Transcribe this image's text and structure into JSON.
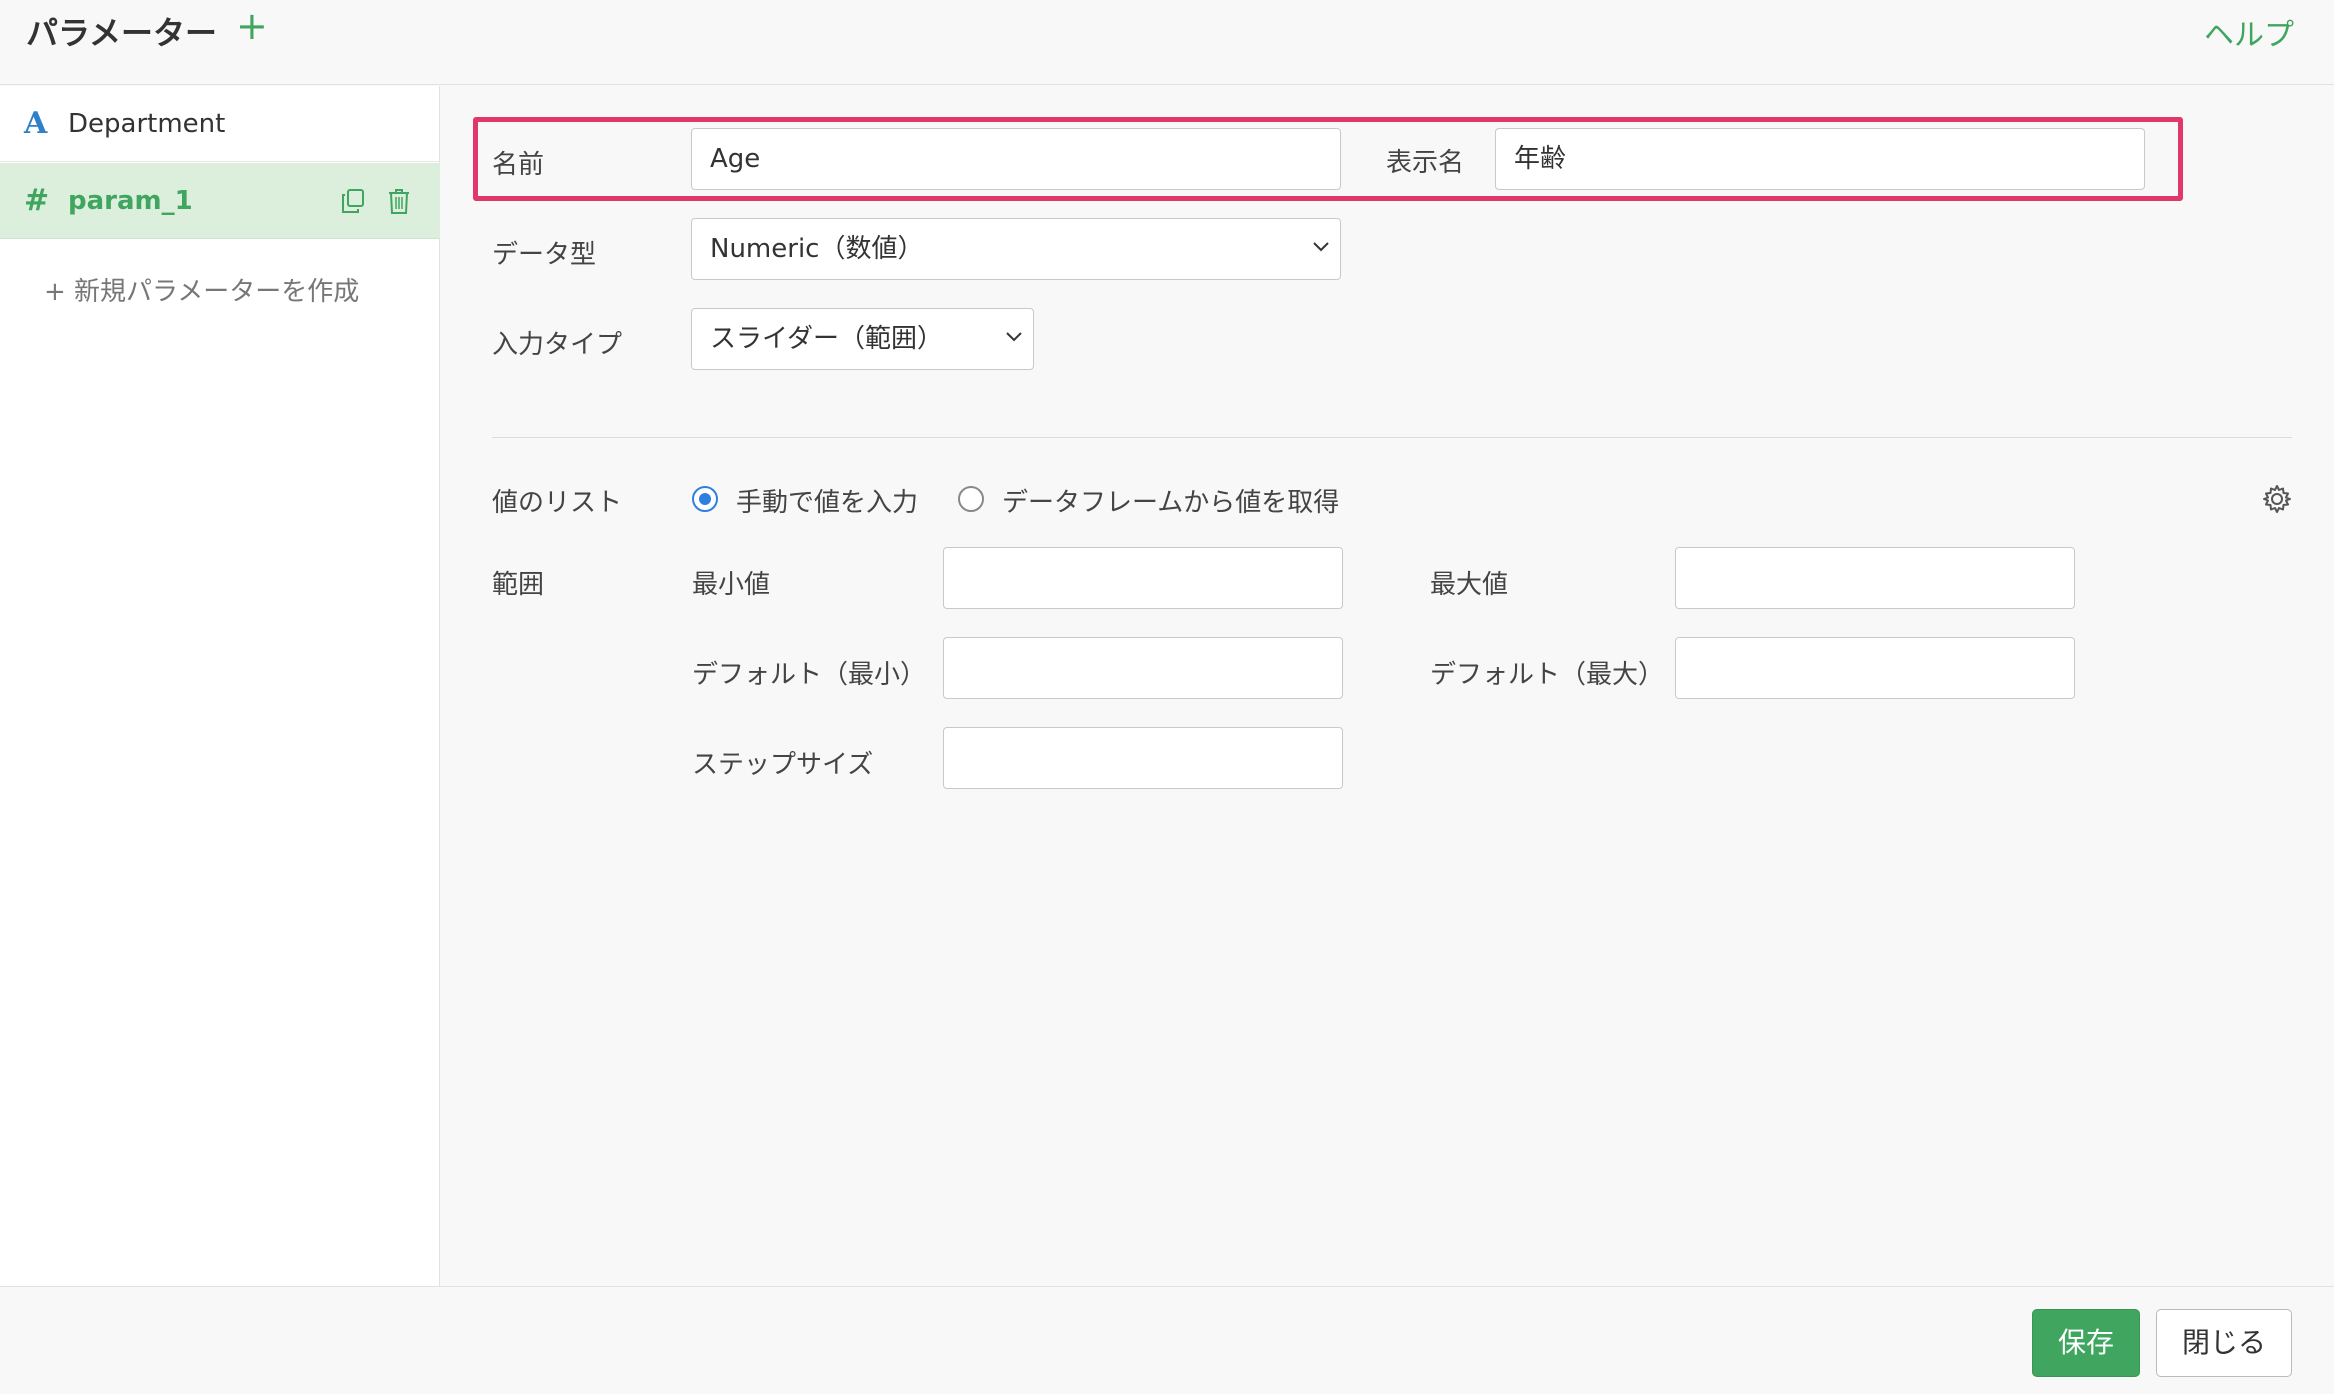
{
  "header": {
    "title": "パラメーター",
    "add_symbol": "+",
    "help_link": "ヘルプ"
  },
  "sidebar": {
    "items": [
      {
        "type_icon": "A",
        "label": "Department",
        "selected": false
      },
      {
        "type_icon": "#",
        "label": "param_1",
        "selected": true
      }
    ],
    "new_param": "+ 新規パラメーターを作成"
  },
  "form": {
    "name_label": "名前",
    "name_value": "Age",
    "display_name_label": "表示名",
    "display_name_value": "年齢",
    "data_type_label": "データ型",
    "data_type_value": "Numeric（数値）",
    "input_type_label": "入力タイプ",
    "input_type_value": "スライダー（範囲）",
    "value_list_label": "値のリスト",
    "value_list_options": [
      {
        "label": "手動で値を入力",
        "checked": true
      },
      {
        "label": "データフレームから値を取得",
        "checked": false
      }
    ],
    "range_label": "範囲",
    "min_label": "最小値",
    "min_value": "",
    "max_label": "最大値",
    "max_value": "",
    "default_min_label": "デフォルト（最小）",
    "default_min_value": "",
    "default_max_label": "デフォルト（最大）",
    "default_max_value": "",
    "step_label": "ステップサイズ",
    "step_value": ""
  },
  "footer": {
    "save_label": "保存",
    "close_label": "閉じる"
  },
  "colors": {
    "accent_green": "#3fa55f",
    "highlight": "#e0386a",
    "selected_row": "#dcefdc",
    "radio_blue": "#2f7fe0"
  },
  "icons": [
    "copy-icon",
    "trash-icon",
    "gear-icon",
    "chevron-down-icon",
    "plus-icon"
  ]
}
